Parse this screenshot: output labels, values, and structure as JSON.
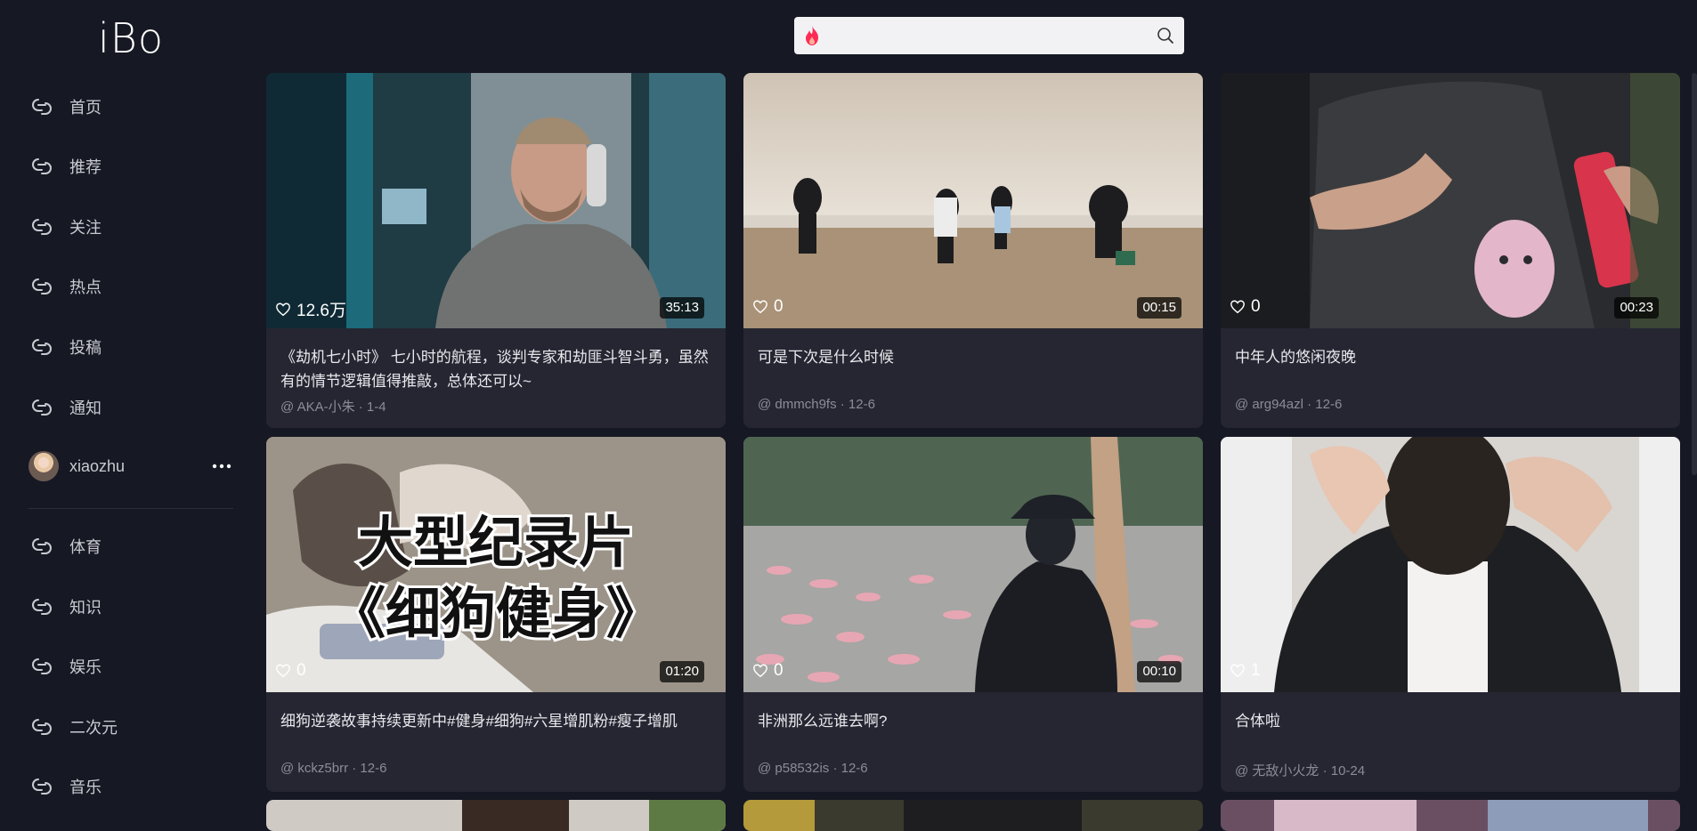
{
  "app": {
    "logo": "iBo"
  },
  "search": {
    "value": "",
    "placeholder": ""
  },
  "sidebar": {
    "items": [
      {
        "label": "首页"
      },
      {
        "label": "推荐"
      },
      {
        "label": "关注"
      },
      {
        "label": "热点"
      },
      {
        "label": "投稿"
      },
      {
        "label": "通知"
      }
    ],
    "user": {
      "name": "xiaozhu"
    },
    "categories": [
      {
        "label": "体育"
      },
      {
        "label": "知识"
      },
      {
        "label": "娱乐"
      },
      {
        "label": "二次元"
      },
      {
        "label": "音乐"
      }
    ]
  },
  "videos": [
    {
      "likes": "12.6万",
      "duration": "35:13",
      "title": "《劫机七小时》 七小时的航程，谈判专家和劫匪斗智斗勇，虽然有的情节逻辑值得推敲，总体还可以~",
      "meta": "@ AKA-小朱 · 1-4"
    },
    {
      "likes": "0",
      "duration": "00:15",
      "title": "可是下次是什么时候",
      "meta": "@ dmmch9fs · 12-6"
    },
    {
      "likes": "0",
      "duration": "00:23",
      "title": "中年人的悠闲夜晚",
      "meta": "@ arg94azl · 12-6"
    },
    {
      "likes": "0",
      "duration": "01:20",
      "title": "细狗逆袭故事持续更新中#健身#细狗#六星增肌粉#瘦子增肌",
      "meta": "@ kckz5brr · 12-6",
      "overlay_line1": "大型纪录片",
      "overlay_line2": "《细狗健身》"
    },
    {
      "likes": "0",
      "duration": "00:10",
      "title": "非洲那么远谁去啊?",
      "meta": "@ p58532is · 12-6"
    },
    {
      "likes": "1",
      "duration": "",
      "title": "合体啦",
      "meta": "@ 无敌小火龙 · 10-24"
    }
  ],
  "colors": {
    "background": "#161823",
    "card": "#252632",
    "accent": "#fe2c55"
  }
}
